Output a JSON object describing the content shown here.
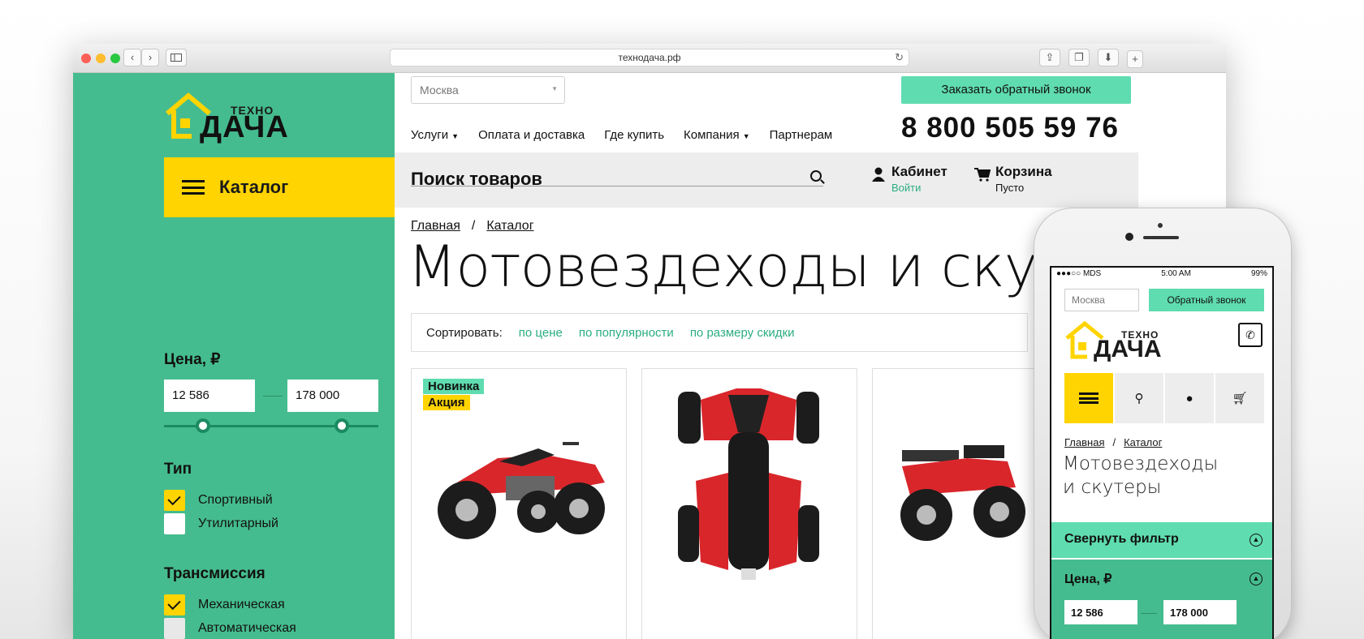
{
  "browser": {
    "url": "технодача.рф",
    "back_icon": "‹",
    "forward_icon": "›"
  },
  "logo": {
    "top": "ТЕХНО",
    "main": "ДАЧА"
  },
  "sidebar": {
    "catalog_label": "Каталог",
    "price_title": "Цена, ₽",
    "price_min": "12 586",
    "price_max": "178 000",
    "price_range_fraction": [
      0.18,
      0.83
    ],
    "type_title": "Тип",
    "type_options": [
      {
        "label": "Спортивный",
        "checked": true
      },
      {
        "label": "Утилитарный",
        "checked": false
      }
    ],
    "transmission_title": "Трансмиссия",
    "transmission_options": [
      {
        "label": "Механическая",
        "checked": true
      },
      {
        "label": "Автоматическая",
        "checked": false
      }
    ]
  },
  "header": {
    "city": "Москва",
    "callback_label": "Заказать обратный звонок",
    "nav": [
      "Услуги",
      "Оплата и доставка",
      "Где купить",
      "Компания",
      "Партнерам"
    ],
    "phone": "8 800 505 59 76",
    "search_placeholder": "Поиск товаров",
    "cabinet_label": "Кабинет",
    "cabinet_sub": "Войти",
    "cart_label": "Корзина",
    "cart_sub": "Пусто"
  },
  "main": {
    "breadcrumbs": [
      "Главная",
      "Каталог"
    ],
    "title": "Мотовездеходы и скутеры",
    "sort_label": "Сортировать:",
    "sort_options": [
      "по цене",
      "по популярности",
      "по размеру скидки"
    ],
    "badges": {
      "new": "Новинка",
      "sale": "Акция"
    }
  },
  "mobile": {
    "carrier": "●●●○○ MDS",
    "time": "5:00 AM",
    "battery": "99%",
    "city": "Москва",
    "callback_label": "Обратный звонок",
    "breadcrumbs": [
      "Главная",
      "Каталог"
    ],
    "title_line1": "Мотовездеходы",
    "title_line2": "и скутеры",
    "collapse_filter": "Свернуть фильтр",
    "price_title": "Цена, ₽",
    "price_min": "12 586",
    "price_max": "178 000"
  },
  "colors": {
    "brand_green": "#45bc8f",
    "accent_mint": "#5fdcb0",
    "brand_yellow": "#ffd400",
    "atv_red": "#d9262b"
  }
}
